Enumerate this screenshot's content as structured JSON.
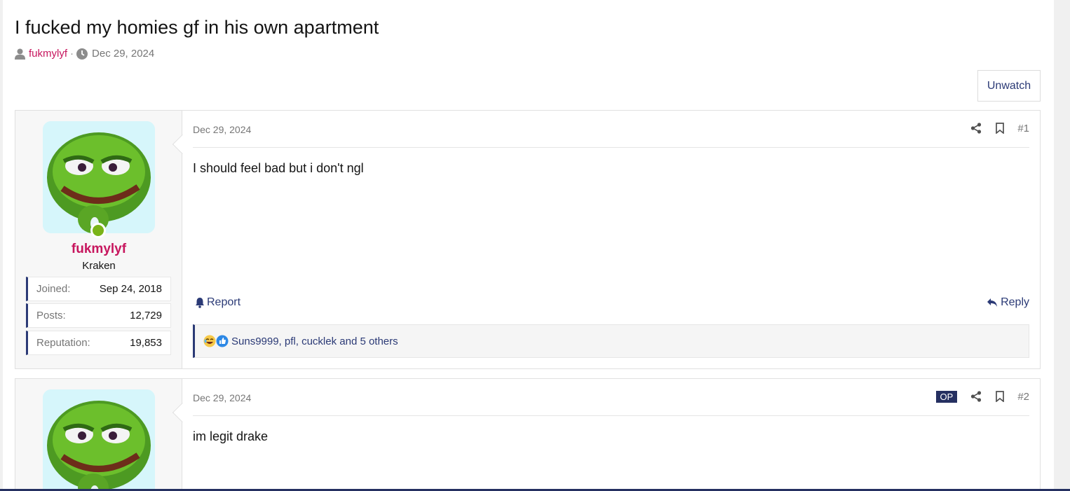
{
  "thread": {
    "title": "I fucked my homies gf in his own apartment",
    "author": "fukmylyf",
    "meta_separator": "·",
    "date": "Dec 29, 2024",
    "unwatch_label": "Unwatch"
  },
  "posts": [
    {
      "user": {
        "name": "fukmylyf",
        "title": "Kraken",
        "stats": [
          {
            "label": "Joined:",
            "value": "Sep 24, 2018"
          },
          {
            "label": "Posts:",
            "value": "12,729"
          },
          {
            "label": "Reputation:",
            "value": "19,853"
          }
        ]
      },
      "date": "Dec 29, 2024",
      "number": "#1",
      "body": "I should feel bad but i don't ngl",
      "report_label": "Report",
      "reply_label": "Reply",
      "reactions_text": "Suns9999, pfl, cucklek and 5 others"
    },
    {
      "date": "Dec 29, 2024",
      "op_badge": "OP",
      "number": "#2",
      "body": "im legit drake"
    }
  ],
  "colors": {
    "accent": "#2b3a76",
    "username": "#c7165e",
    "online": "#7ab317"
  }
}
